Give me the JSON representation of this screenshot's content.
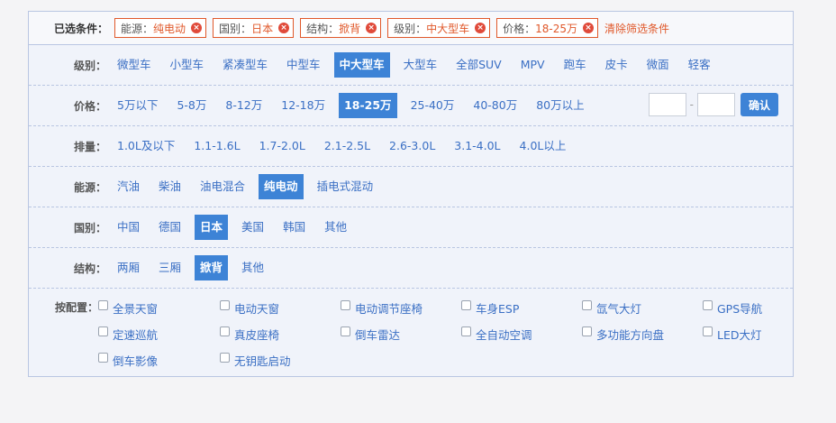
{
  "selected": {
    "label": "已选条件：",
    "chips": [
      {
        "key": "能源：",
        "value": "纯电动"
      },
      {
        "key": "国别：",
        "value": "日本"
      },
      {
        "key": "结构：",
        "value": "掀背"
      },
      {
        "key": "级别：",
        "value": "中大型车"
      },
      {
        "key": "价格：",
        "value": "18-25万"
      }
    ],
    "remove_icon": "×",
    "clear_label": "清除筛选条件"
  },
  "rows": {
    "level": {
      "label": "级别：",
      "options": [
        "微型车",
        "小型车",
        "紧凑型车",
        "中型车",
        "中大型车",
        "大型车",
        "全部SUV",
        "MPV",
        "跑车",
        "皮卡",
        "微面",
        "轻客"
      ],
      "active": 4
    },
    "price": {
      "label": "价格：",
      "options": [
        "5万以下",
        "5-8万",
        "8-12万",
        "12-18万",
        "18-25万",
        "25-40万",
        "40-80万",
        "80万以上"
      ],
      "active": 4,
      "min_value": "",
      "max_value": "",
      "dash": "-",
      "confirm_label": "确认"
    },
    "displacement": {
      "label": "排量：",
      "options": [
        "1.0L及以下",
        "1.1-1.6L",
        "1.7-2.0L",
        "2.1-2.5L",
        "2.6-3.0L",
        "3.1-4.0L",
        "4.0L以上"
      ],
      "active": -1
    },
    "energy": {
      "label": "能源：",
      "options": [
        "汽油",
        "柴油",
        "油电混合",
        "纯电动",
        "插电式混动"
      ],
      "active": 3
    },
    "country": {
      "label": "国别：",
      "options": [
        "中国",
        "德国",
        "日本",
        "美国",
        "韩国",
        "其他"
      ],
      "active": 2
    },
    "structure": {
      "label": "结构：",
      "options": [
        "两厢",
        "三厢",
        "掀背",
        "其他"
      ],
      "active": 2
    }
  },
  "config": {
    "label": "按配置：",
    "items": [
      {
        "label": "全景天窗",
        "checked": false
      },
      {
        "label": "电动天窗",
        "checked": false
      },
      {
        "label": "电动调节座椅",
        "checked": false
      },
      {
        "label": "车身ESP",
        "checked": false
      },
      {
        "label": "氙气大灯",
        "checked": false
      },
      {
        "label": "GPS导航",
        "checked": false
      },
      {
        "label": "定速巡航",
        "checked": false
      },
      {
        "label": "真皮座椅",
        "checked": false
      },
      {
        "label": "倒车雷达",
        "checked": false
      },
      {
        "label": "全自动空调",
        "checked": false
      },
      {
        "label": "多功能方向盘",
        "checked": false
      },
      {
        "label": "LED大灯",
        "checked": false
      },
      {
        "label": "倒车影像",
        "checked": false
      },
      {
        "label": "无钥匙启动",
        "checked": false
      }
    ]
  },
  "colors": {
    "accent": "#3d83d6",
    "chip_border": "#e0582a",
    "link": "#3a6fc4",
    "remove": "#e04a3a"
  }
}
